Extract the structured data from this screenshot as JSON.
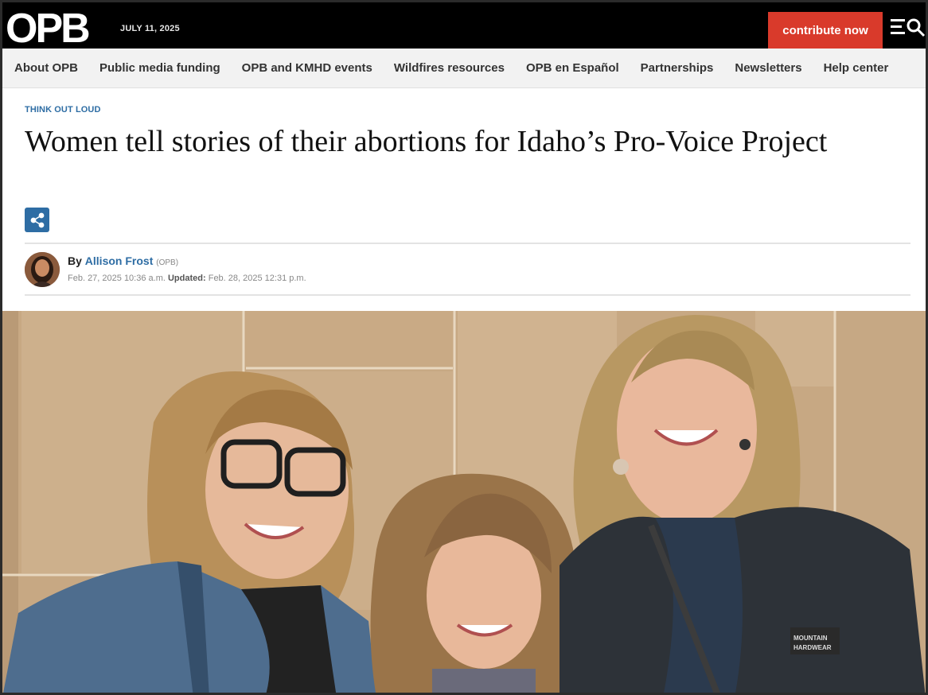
{
  "header": {
    "logo_text": "OPB",
    "date": "JULY 11, 2025",
    "contribute_label": "contribute now"
  },
  "nav": {
    "items": [
      {
        "label": "About OPB"
      },
      {
        "label": "Public media funding"
      },
      {
        "label": "OPB and KMHD events"
      },
      {
        "label": "Wildfires resources"
      },
      {
        "label": "OPB en Español"
      },
      {
        "label": "Partnerships"
      },
      {
        "label": "Newsletters"
      },
      {
        "label": "Help center"
      }
    ]
  },
  "article": {
    "kicker": "THINK OUT LOUD",
    "headline": "Women tell stories of their abortions for Idaho’s Pro-Voice Project",
    "byline": {
      "by": "By",
      "author": "Allison Frost",
      "org": "(OPB)",
      "published": "Feb. 27, 2025 10:36 a.m.",
      "updated_label": "Updated:",
      "updated": "Feb. 28, 2025 12:31 p.m."
    }
  },
  "colors": {
    "brand_red": "#d93a2b",
    "link_blue": "#2e6da4",
    "topbar_bg": "#000000"
  },
  "icons": {
    "share": "share-icon",
    "menu": "hamburger-menu-icon",
    "search": "search-icon"
  }
}
